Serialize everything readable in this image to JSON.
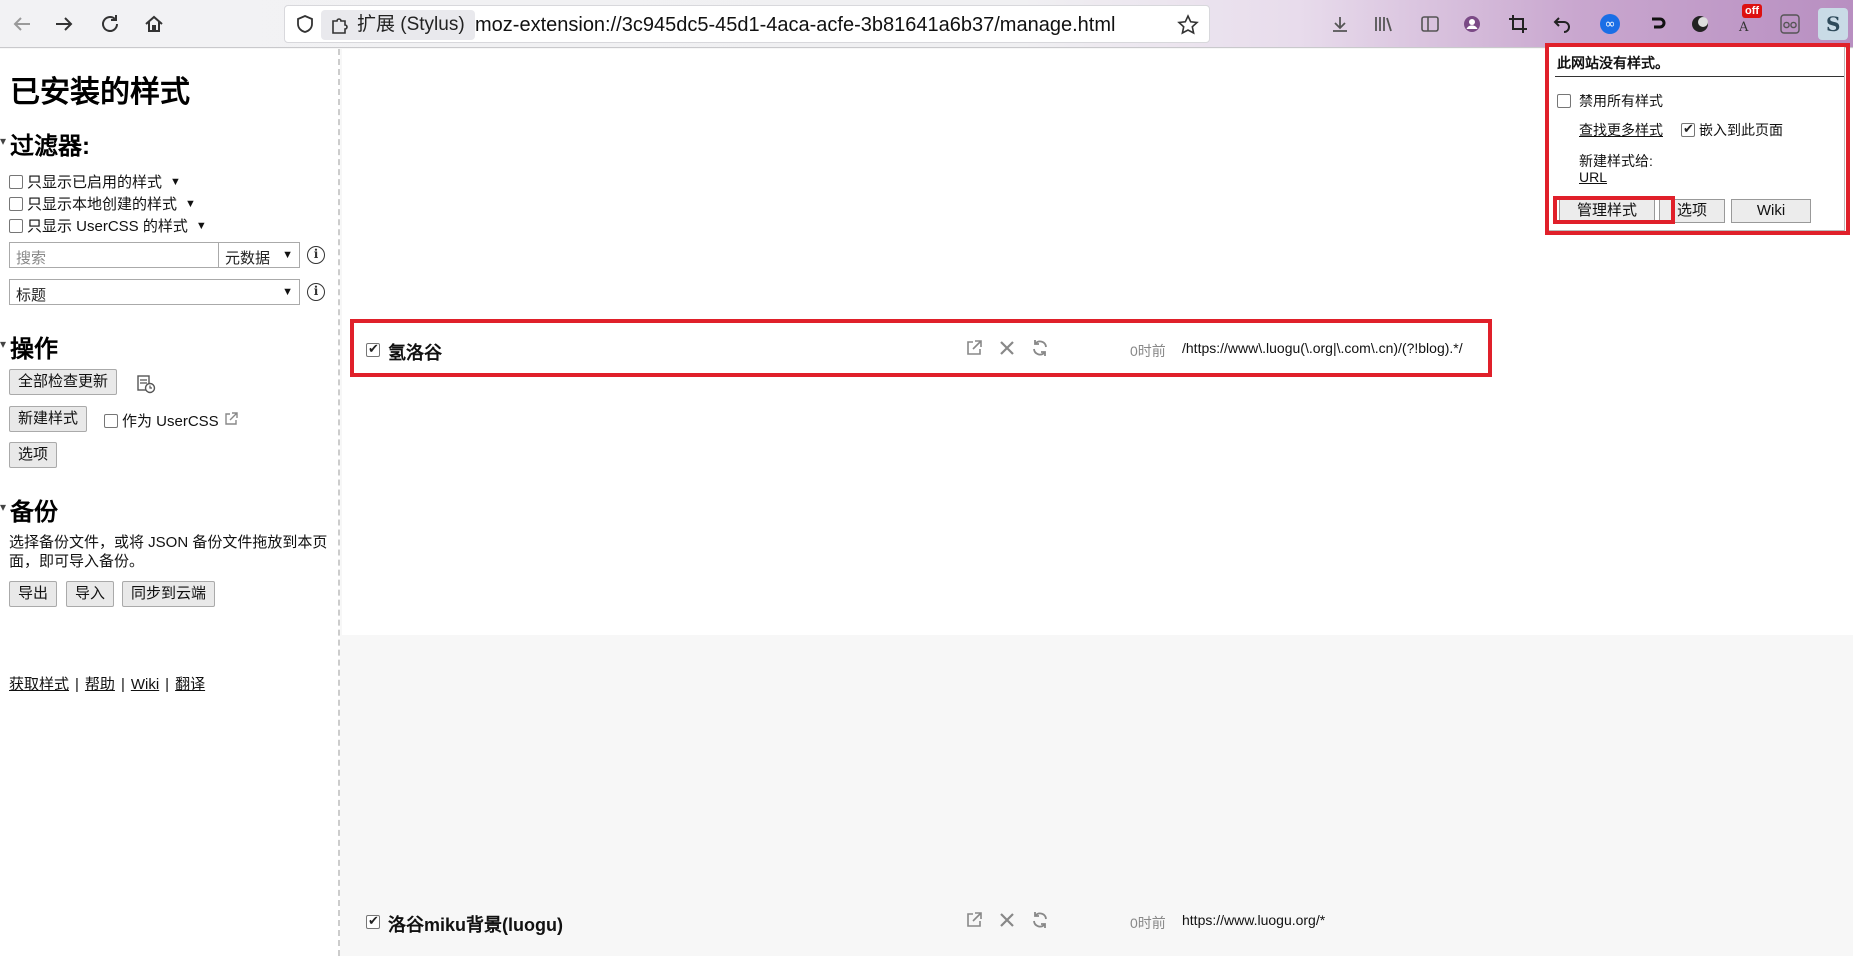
{
  "browser": {
    "url_chip_label": "扩展 (Stylus)",
    "url": "moz-extension://3c945dc5-45d1-4aca-acfe-3b81641a6b37/manage.html",
    "extension_badge": "off"
  },
  "sidebar": {
    "title": "已安装的样式",
    "filters": {
      "heading": "过滤器:",
      "only_enabled": "只显示已启用的样式",
      "only_local": "只显示本地创建的样式",
      "only_usercss": "只显示 UserCSS 的样式",
      "search_placeholder": "搜索",
      "search_scope": "元数据",
      "sort": "标题"
    },
    "actions": {
      "heading": "操作",
      "check_all_updates": "全部检查更新",
      "new_style": "新建样式",
      "as_usercss": "作为 UserCSS",
      "options": "选项"
    },
    "backup": {
      "heading": "备份",
      "description": "选择备份文件，或将 JSON 备份文件拖放到本页面，即可导入备份。",
      "export": "导出",
      "import": "导入",
      "sync": "同步到云端"
    },
    "links": {
      "get_styles": "获取样式",
      "help": "帮助",
      "wiki": "Wiki",
      "translate": "翻译"
    }
  },
  "styles": [
    {
      "name": "氢洛谷",
      "enabled": true,
      "age": "0时前",
      "applies_to": "/https://www\\.luogu(\\.org|\\.com\\.cn)/(?!blog).*/"
    },
    {
      "name": "洛谷miku背景(luogu)",
      "enabled": true,
      "age": "0时前",
      "applies_to": "https://www.luogu.org/*"
    }
  ],
  "popup": {
    "no_styles": "此网站没有样式。",
    "disable_all": "禁用所有样式",
    "find_more": "查找更多样式",
    "inline_page": "嵌入到此页面",
    "inline_checked": true,
    "new_style_for": "新建样式给:",
    "url_link": "URL",
    "manage": "管理样式",
    "options": "选项",
    "wiki": "Wiki"
  },
  "colors": {
    "highlight": "#e0202a"
  }
}
